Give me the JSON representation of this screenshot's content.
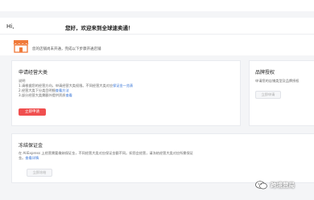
{
  "header": {
    "greeting": "Hi,",
    "welcome": "您好，欢迎来到全球速卖通！"
  },
  "notice": {
    "text": "您的店铺尚未开通，完成以下步骤开通店铺"
  },
  "category_card": {
    "title": "申请经营大类",
    "label": "说明",
    "line1_prefix": "1.请根据您的经营方向，申请经营大类权限。不同经营大类对应",
    "line1_link": "保证金一览表",
    "line2_prefix": "2.经营大类下分类目明细",
    "line2_link": "查看方法",
    "line3_prefix": "3.部分经营大类需额外提供资质",
    "line3_link": "查看",
    "button": "立即申请"
  },
  "brand_card": {
    "title": "品牌授权",
    "desc": "申请您的店铺类型及品牌授权",
    "button": "立即申请"
  },
  "deposit_card": {
    "title": "冻结保证金",
    "line1": "在 AliExpress 上经营需要缴纳保证金，不同经营大类对应保证金额不同。如您会经营，请冻结经营大类对应所需保证",
    "line2_prefix": "金。",
    "line2_link": "查看详情",
    "button": "立即冻结"
  },
  "watermark": {
    "text": "跨境营局"
  }
}
